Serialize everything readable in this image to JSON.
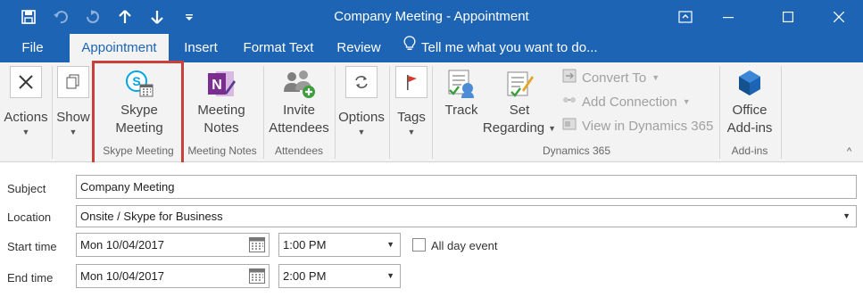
{
  "window": {
    "title": "Company Meeting - Appointment",
    "controls": [
      "restore-ribbon",
      "minimize",
      "maximize",
      "close"
    ]
  },
  "qat": {
    "items": [
      "save-icon",
      "undo-icon",
      "redo-icon",
      "up-arrow-icon",
      "down-arrow-icon",
      "customize-icon"
    ]
  },
  "tabs": {
    "file": "File",
    "appointment": "Appointment",
    "insert": "Insert",
    "format_text": "Format Text",
    "review": "Review",
    "tell_me": "Tell me what you want to do..."
  },
  "ribbon": {
    "actions": "Actions",
    "show": "Show",
    "skype_line1": "Skype",
    "skype_line2": "Meeting",
    "skype_group": "Skype Meeting",
    "notes_line1": "Meeting",
    "notes_line2": "Notes",
    "notes_group": "Meeting Notes",
    "invite_line1": "Invite",
    "invite_line2": "Attendees",
    "attendees_group": "Attendees",
    "options": "Options",
    "tags": "Tags",
    "track": "Track",
    "set_line1": "Set",
    "set_line2": "Regarding",
    "convert_to": "Convert To",
    "add_connection": "Add Connection",
    "view_dynamics": "View in Dynamics 365",
    "dynamics_group": "Dynamics 365",
    "office_line1": "Office",
    "office_line2": "Add-ins",
    "addins_group": "Add-ins"
  },
  "form": {
    "subject_label": "Subject",
    "subject_value": "Company Meeting",
    "location_label": "Location",
    "location_value": "Onsite / Skype for Business",
    "start_label": "Start time",
    "start_date": "Mon 10/04/2017",
    "start_time": "1:00 PM",
    "all_day_label": "All day event",
    "all_day_checked": false,
    "end_label": "End time",
    "end_date": "Mon 10/04/2017",
    "end_time": "2:00 PM"
  },
  "colors": {
    "brand_blue": "#1e64b5",
    "highlight_red": "#c9403a",
    "onenote_purple": "#7a2e8e",
    "skype_blue": "#00a5e3"
  }
}
